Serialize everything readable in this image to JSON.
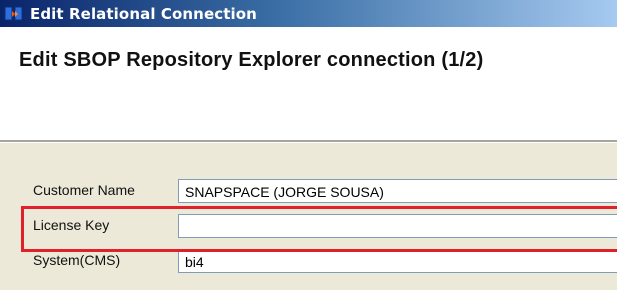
{
  "window": {
    "title": "Edit Relational Connection",
    "icon": "relational-connection-icon"
  },
  "dialog": {
    "heading": "Edit SBOP Repository Explorer connection (1/2)"
  },
  "form": {
    "fields": [
      {
        "label": "Customer Name",
        "value": "SNAPSPACE (JORGE SOUSA)"
      },
      {
        "label": "License Key",
        "value": ""
      },
      {
        "label": "System(CMS)",
        "value": "bi4"
      }
    ]
  },
  "colors": {
    "titlebar_start": "#0a246a",
    "titlebar_end": "#a6caf0",
    "panel_background": "#ece9d8",
    "highlight": "#e0202a"
  }
}
